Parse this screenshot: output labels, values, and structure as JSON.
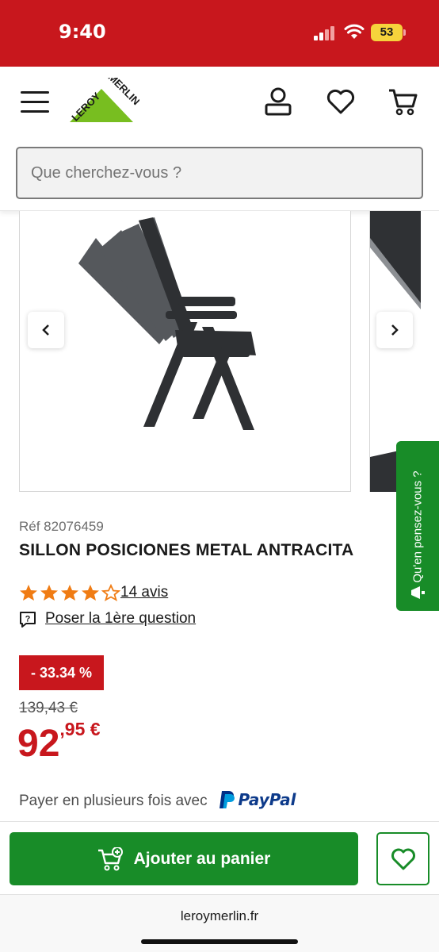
{
  "status": {
    "time": "9:40",
    "battery": "53"
  },
  "header": {
    "logo_text": "LEROY MERLIN"
  },
  "search": {
    "placeholder": "Que cherchez-vous ?"
  },
  "product": {
    "ref": "Réf 82076459",
    "title": "SILLON POSICIONES METAL ANTRACITA",
    "rating": 4,
    "rating_max": 5,
    "reviews": "14 avis",
    "question": "Poser la 1ère question",
    "discount": "- 33.34 %",
    "old_price": "139,43 €",
    "price_int": "92",
    "price_dec": ",95 €",
    "payment_text": "Payer en plusieurs fois avec",
    "paypal": "PayPal"
  },
  "feedback": {
    "label": "Qu'en pensez-vous ?"
  },
  "actions": {
    "add_to_cart": "Ajouter au panier"
  },
  "browser": {
    "url": "leroymerlin.fr"
  },
  "colors": {
    "brand_red": "#c8171d",
    "brand_green": "#188c28",
    "star": "#f07c14"
  }
}
